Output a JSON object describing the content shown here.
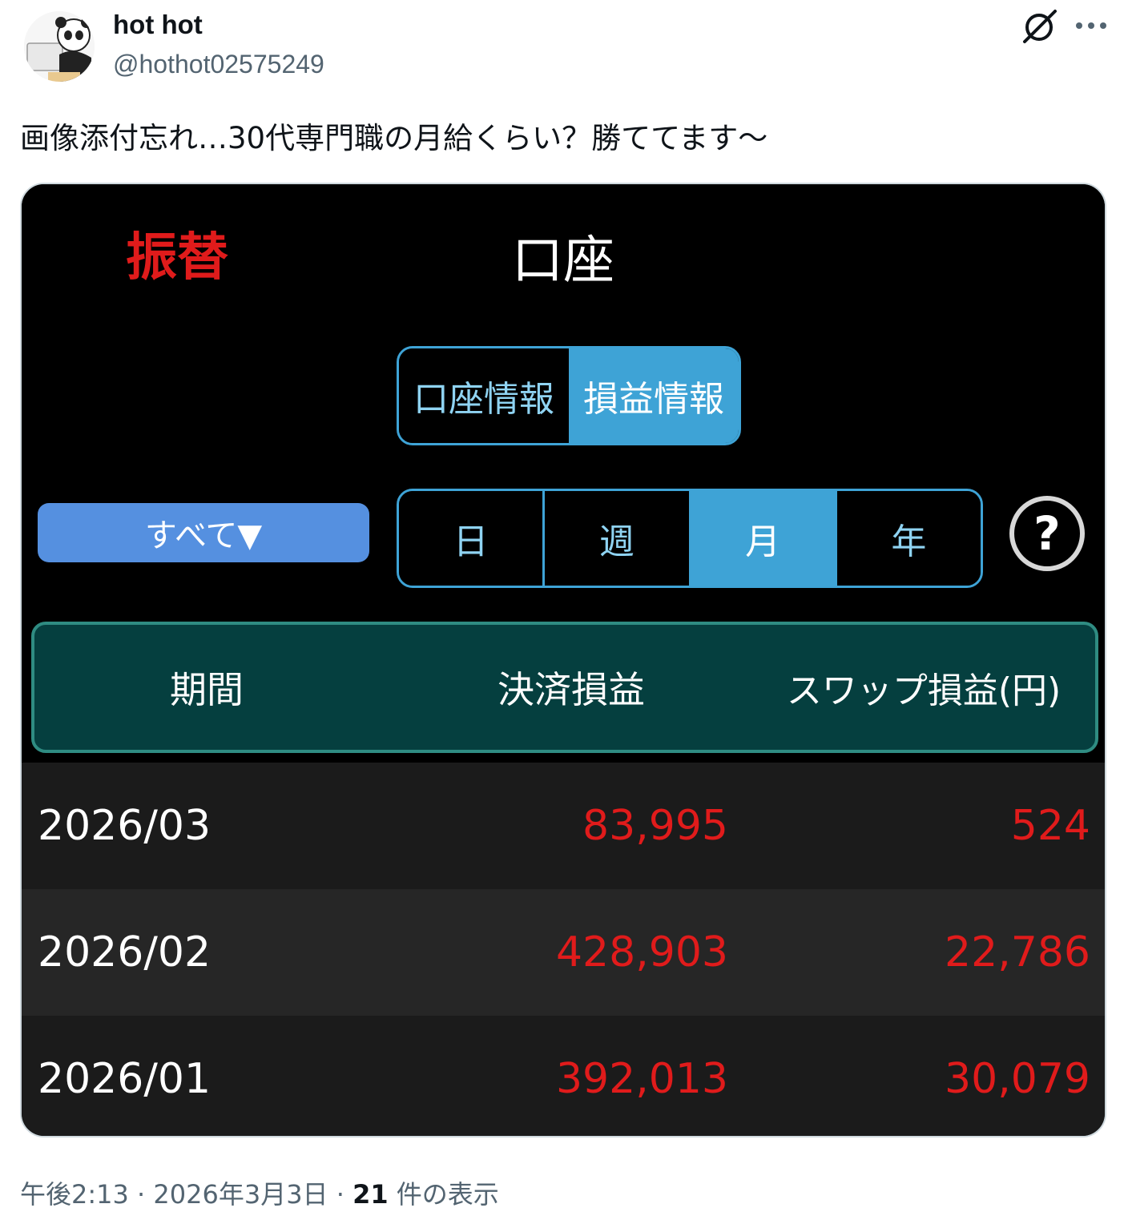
{
  "author": {
    "display_name": "hot hot",
    "handle": "@hothot02575249"
  },
  "tweet": {
    "text": "画像添付忘れ…30代専門職の月給くらい？勝ててます〜"
  },
  "app": {
    "transfer_label": "振替",
    "title": "口座",
    "info_tabs": [
      {
        "label": "口座情報",
        "active": false
      },
      {
        "label": "損益情報",
        "active": true
      }
    ],
    "filter_button": "すべて▼",
    "period_tabs": [
      {
        "label": "日",
        "active": false
      },
      {
        "label": "週",
        "active": false
      },
      {
        "label": "月",
        "active": true
      },
      {
        "label": "年",
        "active": false
      }
    ],
    "table": {
      "headers": [
        "期間",
        "決済損益",
        "スワップ損益(円)"
      ],
      "rows": [
        {
          "period": "2026/03",
          "settlement": "83,995",
          "swap": "524"
        },
        {
          "period": "2026/02",
          "settlement": "428,903",
          "swap": "22,786"
        },
        {
          "period": "2026/01",
          "settlement": "392,013",
          "swap": "30,079"
        }
      ]
    },
    "colors": {
      "accent": "#3ea3d6",
      "profit": "#e01b1b",
      "header_bg": "#053f3f"
    }
  },
  "meta": {
    "time": "午後2:13",
    "separator": " · ",
    "date": "2026年3月3日",
    "views_count": "21",
    "views_label": " 件の表示"
  }
}
